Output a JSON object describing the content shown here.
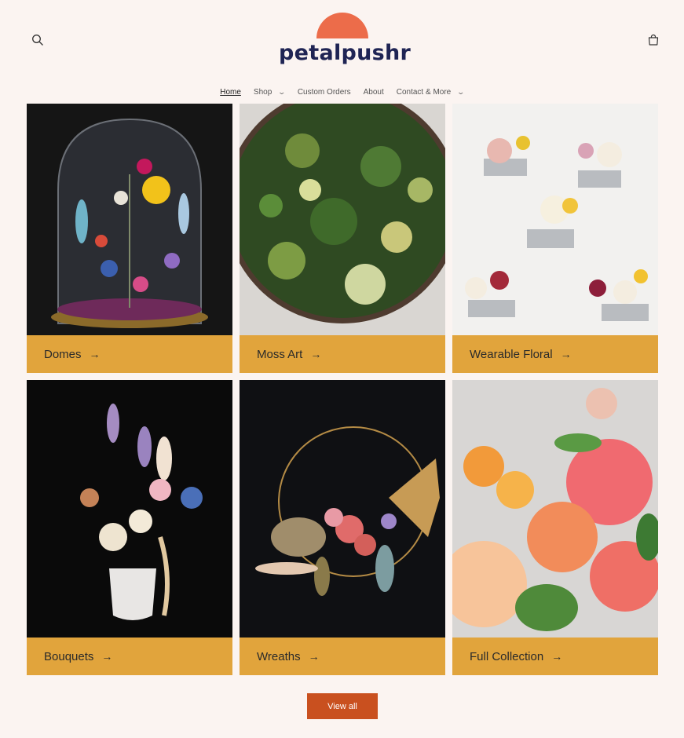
{
  "brand": {
    "name": "petalpushr",
    "sun_color": "#ec6c4a",
    "text_color": "#1f2454"
  },
  "header": {
    "search_icon": "search-icon",
    "cart_icon": "cart-icon"
  },
  "nav": {
    "items": [
      {
        "label": "Home",
        "active": true,
        "dropdown": false
      },
      {
        "label": "Shop",
        "active": false,
        "dropdown": true
      },
      {
        "label": "Custom Orders",
        "active": false,
        "dropdown": false
      },
      {
        "label": "About",
        "active": false,
        "dropdown": false
      },
      {
        "label": "Contact & More",
        "active": false,
        "dropdown": true
      }
    ]
  },
  "collections": [
    {
      "label": "Domes"
    },
    {
      "label": "Moss Art"
    },
    {
      "label": "Wearable Floral"
    },
    {
      "label": "Bouquets"
    },
    {
      "label": "Wreaths"
    },
    {
      "label": "Full Collection"
    }
  ],
  "view_all": {
    "label": "View all"
  },
  "colors": {
    "background": "#fbf4f1",
    "card_bar": "#e1a43c",
    "button": "#c9501f"
  }
}
